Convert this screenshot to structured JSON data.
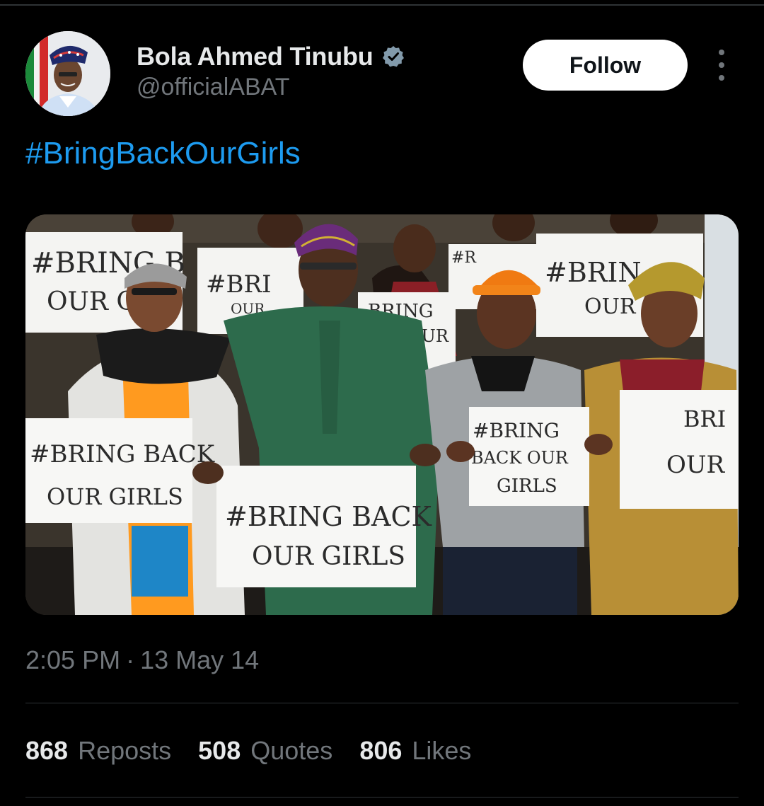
{
  "author": {
    "display_name": "Bola Ahmed Tinubu",
    "handle": "@officialABAT",
    "verified": true
  },
  "actions": {
    "follow_label": "Follow"
  },
  "tweet": {
    "text": "#BringBackOurGirls",
    "media_signs": {
      "sign_1": "#BRING B",
      "sign_1b": "OUR G",
      "sign_2": "#BRI",
      "sign_2b": "OUR",
      "sign_3": "BRING",
      "sign_3b": "OUR",
      "sign_4": "#BRIN",
      "sign_4b": "OUR",
      "sign_5": "#BRING BACK",
      "sign_5b": "OUR GIRLS",
      "sign_6": "#BRING BACK",
      "sign_6b": "OUR GIRLS",
      "sign_7": "#BRING",
      "sign_7b": "BACK OUR",
      "sign_7c": "GIRLS",
      "sign_8": "BRI",
      "sign_8b": "OUR",
      "sign_9": "#R"
    },
    "time": "2:05 PM",
    "separator": "·",
    "date": "13 May 14"
  },
  "stats": {
    "reposts_count": "868",
    "reposts_label": "Reposts",
    "quotes_count": "508",
    "quotes_label": "Quotes",
    "likes_count": "806",
    "likes_label": "Likes"
  },
  "colors": {
    "background": "#000000",
    "link": "#1d9bf0",
    "secondary_text": "#71767b",
    "verified": "#829aab"
  }
}
